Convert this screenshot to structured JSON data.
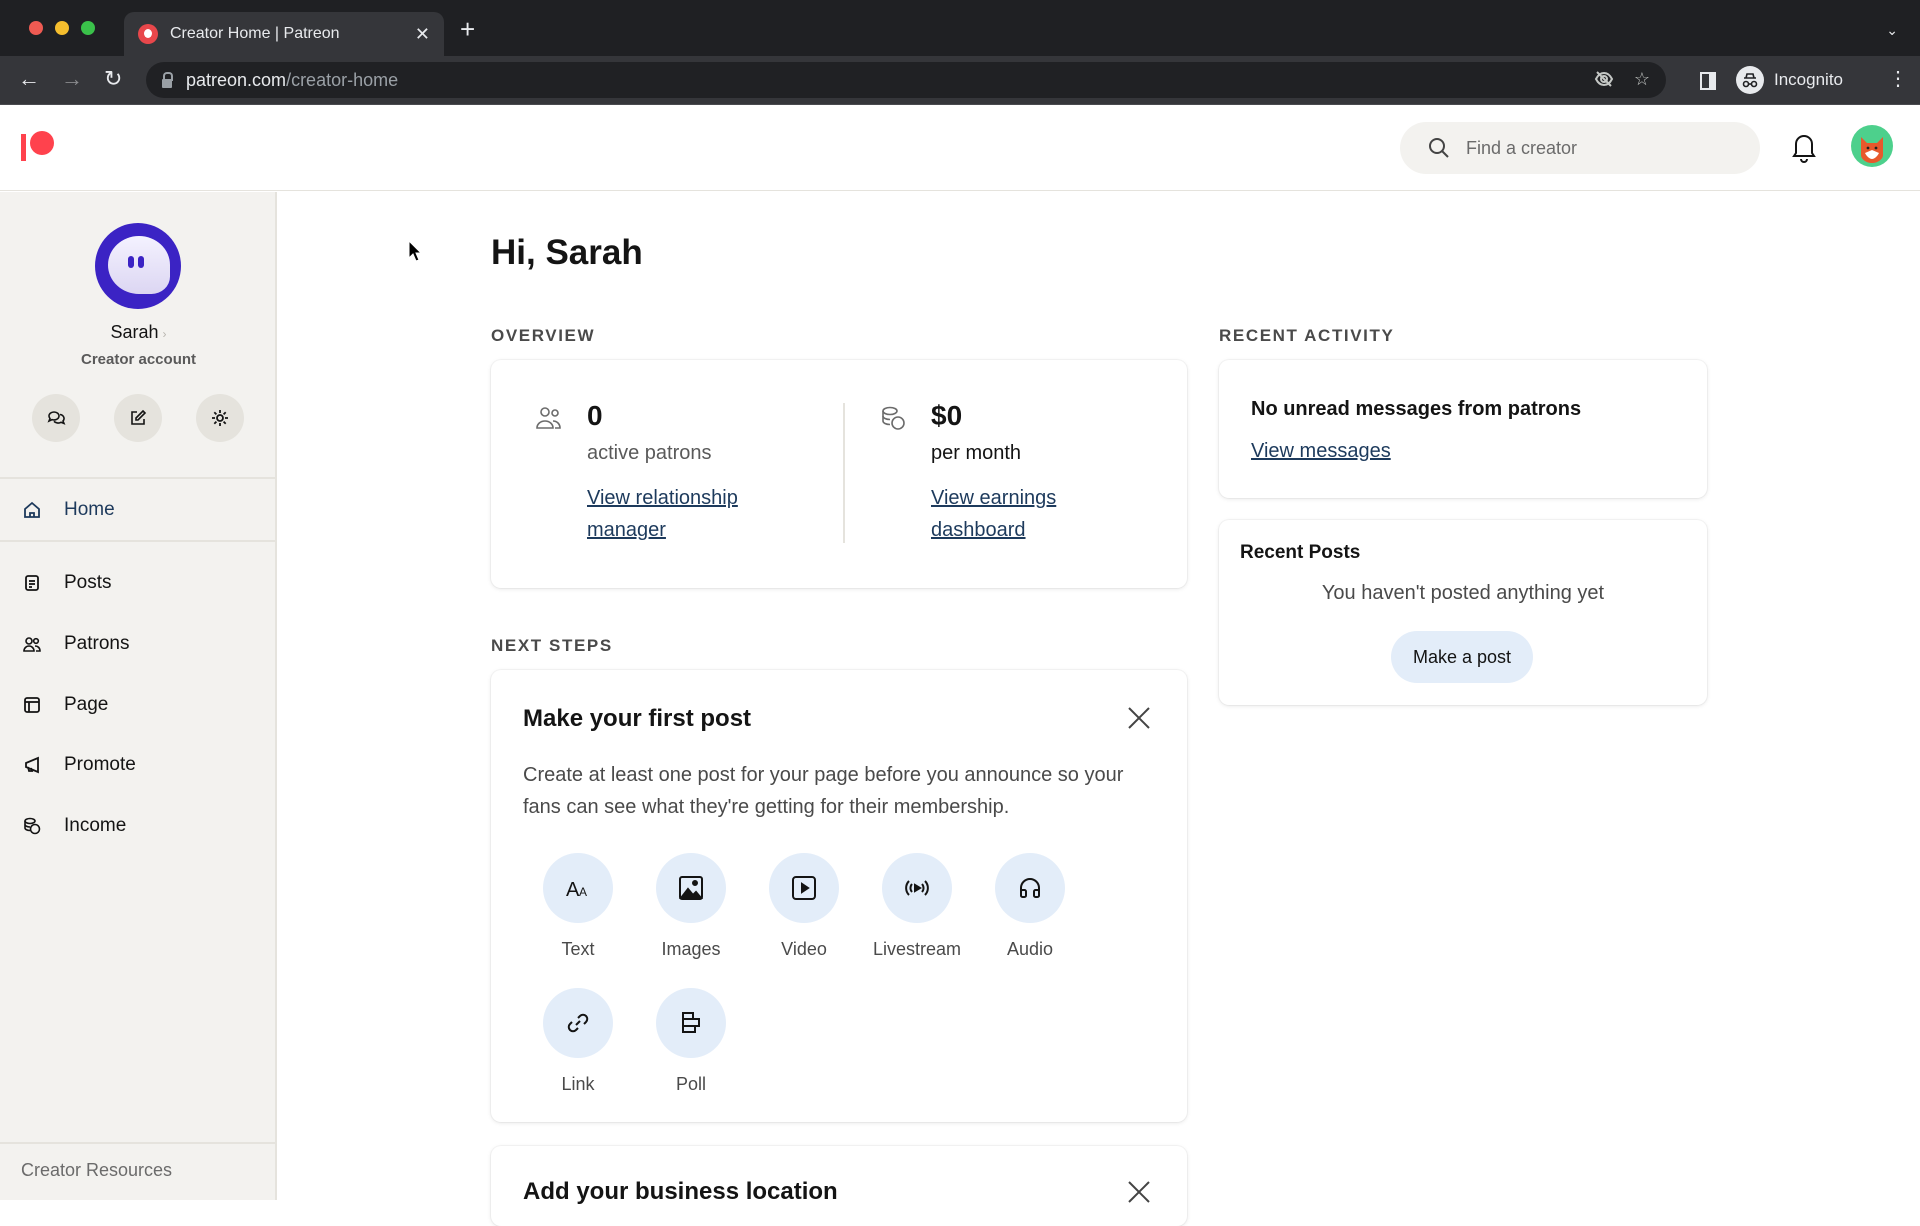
{
  "browser": {
    "tab_title": "Creator Home | Patreon",
    "url_host": "patreon.com",
    "url_path": "/creator-home",
    "profile_label": "Incognito"
  },
  "header": {
    "search_placeholder": "Find a creator",
    "brand_color": "#FF424D"
  },
  "sidebar": {
    "user_name": "Sarah",
    "account_type": "Creator account",
    "quick_actions": [
      {
        "icon": "chat-bubbles-icon",
        "label": "Messages"
      },
      {
        "icon": "edit-icon",
        "label": "Create"
      },
      {
        "icon": "gear-icon",
        "label": "Settings"
      }
    ],
    "items": [
      {
        "label": "Home",
        "icon": "home-icon",
        "active": true
      },
      {
        "label": "Posts",
        "icon": "document-icon"
      },
      {
        "label": "Patrons",
        "icon": "people-icon"
      },
      {
        "label": "Page",
        "icon": "layout-icon"
      },
      {
        "label": "Promote",
        "icon": "megaphone-icon"
      },
      {
        "label": "Income",
        "icon": "coins-icon"
      }
    ],
    "footer_label": "Creator Resources"
  },
  "main": {
    "greeting": "Hi, Sarah",
    "overview": {
      "label": "OVERVIEW",
      "patrons": {
        "value": "0",
        "label": "active patrons",
        "link": "View relationship manager"
      },
      "earnings": {
        "value": "$0",
        "label": "per month",
        "link": "View earnings dashboard"
      }
    },
    "recent_activity": {
      "label": "RECENT ACTIVITY",
      "messages_title": "No unread messages from patrons",
      "messages_link": "View messages",
      "posts_title": "Recent Posts",
      "posts_empty": "You haven't posted anything yet",
      "posts_button": "Make a post"
    },
    "next_steps": {
      "label": "NEXT STEPS",
      "first_post": {
        "title": "Make your first post",
        "description": "Create at least one post for your page before you announce so your fans can see what they're getting for their membership.",
        "post_types": [
          {
            "label": "Text",
            "icon": "text-icon"
          },
          {
            "label": "Images",
            "icon": "image-icon"
          },
          {
            "label": "Video",
            "icon": "video-icon"
          },
          {
            "label": "Livestream",
            "icon": "livestream-icon"
          },
          {
            "label": "Audio",
            "icon": "headphones-icon"
          },
          {
            "label": "Link",
            "icon": "link-icon"
          },
          {
            "label": "Poll",
            "icon": "poll-icon"
          }
        ]
      },
      "business_location": {
        "title": "Add your business location"
      }
    }
  }
}
